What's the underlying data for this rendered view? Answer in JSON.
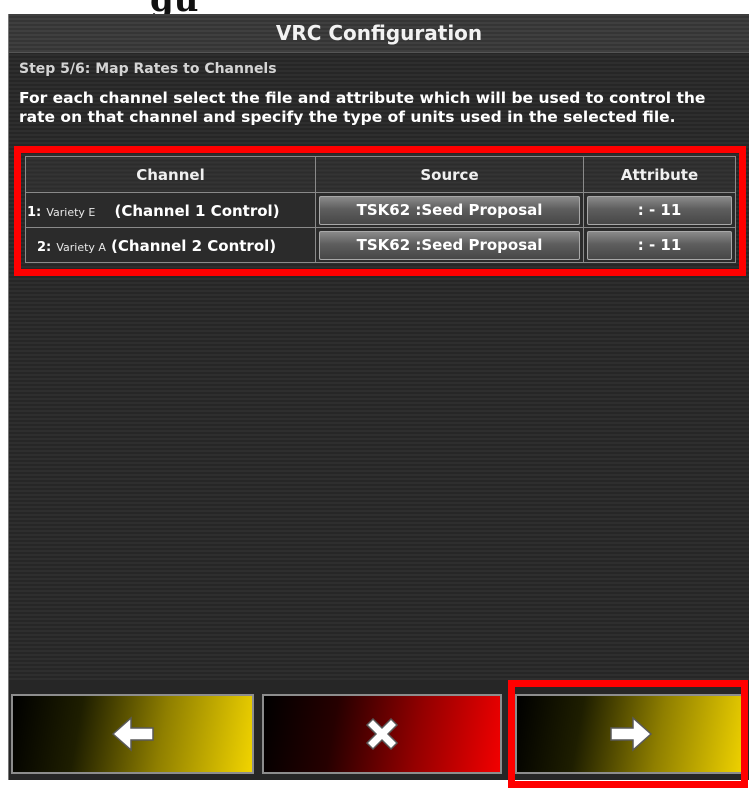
{
  "dialog": {
    "title": "VRC Configuration",
    "step": "Step 5/6: Map Rates to Channels",
    "instructions": "For each channel select the file and attribute which will be used to control the rate on that channel and specify the type of units used in the selected file."
  },
  "table": {
    "headers": {
      "channel": "Channel",
      "source": "Source",
      "attribute": "Attribute"
    },
    "rows": [
      {
        "number": "1:",
        "variety": "Variety E",
        "control": "(Channel 1 Control)",
        "source": "TSK62 :Seed Proposal",
        "attribute": ": - 11"
      },
      {
        "number": "2:",
        "variety": "Variety A",
        "control": "(Channel 2 Control)",
        "source": "TSK62 :Seed Proposal",
        "attribute": ": - 11"
      }
    ]
  },
  "nav": {
    "back_icon": "arrow-left-icon",
    "cancel_icon": "close-x-icon",
    "next_icon": "arrow-right-icon"
  },
  "colors": {
    "highlight": "#ff0000",
    "nav_yellow": "#f1d400",
    "cancel_red": "#f20000"
  }
}
